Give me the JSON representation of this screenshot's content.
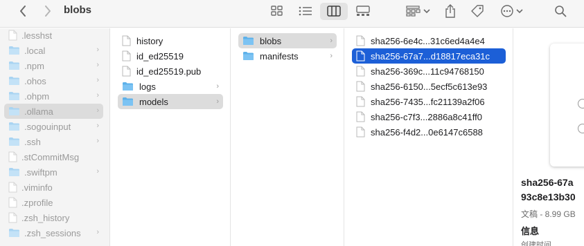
{
  "window": {
    "title": "blobs"
  },
  "toolbar": {
    "back_icon": "chevron-left-icon",
    "forward_icon": "chevron-right-icon",
    "view_icons": [
      "grid-view-icon",
      "list-view-icon",
      "column-view-icon",
      "gallery-view-icon"
    ],
    "group_icon": "group-by-icon",
    "share_icon": "share-icon",
    "tag_icon": "tag-icon",
    "more_icon": "ellipsis-circle-icon",
    "search_icon": "search-icon"
  },
  "sidebar": {
    "items": [
      {
        "label": ".lesshst",
        "type": "file"
      },
      {
        "label": ".local",
        "type": "folder"
      },
      {
        "label": ".npm",
        "type": "folder"
      },
      {
        "label": ".ohos",
        "type": "folder"
      },
      {
        "label": ".ohpm",
        "type": "folder"
      },
      {
        "label": ".ollama",
        "type": "folder",
        "selected": true
      },
      {
        "label": ".sogouinput",
        "type": "folder"
      },
      {
        "label": ".ssh",
        "type": "folder"
      },
      {
        "label": ".stCommitMsg",
        "type": "file"
      },
      {
        "label": ".swiftpm",
        "type": "folder"
      },
      {
        "label": ".viminfo",
        "type": "file"
      },
      {
        "label": ".zprofile",
        "type": "file"
      },
      {
        "label": ".zsh_history",
        "type": "file"
      },
      {
        "label": ".zsh_sessions",
        "type": "folder"
      }
    ]
  },
  "column1": {
    "items": [
      {
        "label": "history",
        "type": "file"
      },
      {
        "label": "id_ed25519",
        "type": "file"
      },
      {
        "label": "id_ed25519.pub",
        "type": "file"
      },
      {
        "label": "logs",
        "type": "folder"
      },
      {
        "label": "models",
        "type": "folder",
        "selected": true
      }
    ]
  },
  "column2": {
    "items": [
      {
        "label": "blobs",
        "type": "folder",
        "selected": true
      },
      {
        "label": "manifests",
        "type": "folder"
      }
    ]
  },
  "column3": {
    "items": [
      {
        "label": "sha256-6e4c...31c6ed4a4e4",
        "type": "file"
      },
      {
        "label": "sha256-67a7...d18817eca31c",
        "type": "file",
        "selected": true
      },
      {
        "label": "sha256-369c...11c94768150",
        "type": "file"
      },
      {
        "label": "sha256-6150...5ecf5c613e93",
        "type": "file"
      },
      {
        "label": "sha256-7435...fc21139a2f06",
        "type": "file"
      },
      {
        "label": "sha256-c7f3...2886a8c41ff0",
        "type": "file"
      },
      {
        "label": "sha256-f4d2...0e6147c6588",
        "type": "file"
      }
    ]
  },
  "preview": {
    "name_line1": "sha256-67a",
    "name_line2": "93c8e13b30",
    "meta": "文稿 - 8.99 GB",
    "info_label": "信息",
    "created_label": "创建时间"
  },
  "colors": {
    "accent": "#1c5fd7",
    "folder": "#5db1ea",
    "sidebar_bg": "#f4f4f4"
  }
}
